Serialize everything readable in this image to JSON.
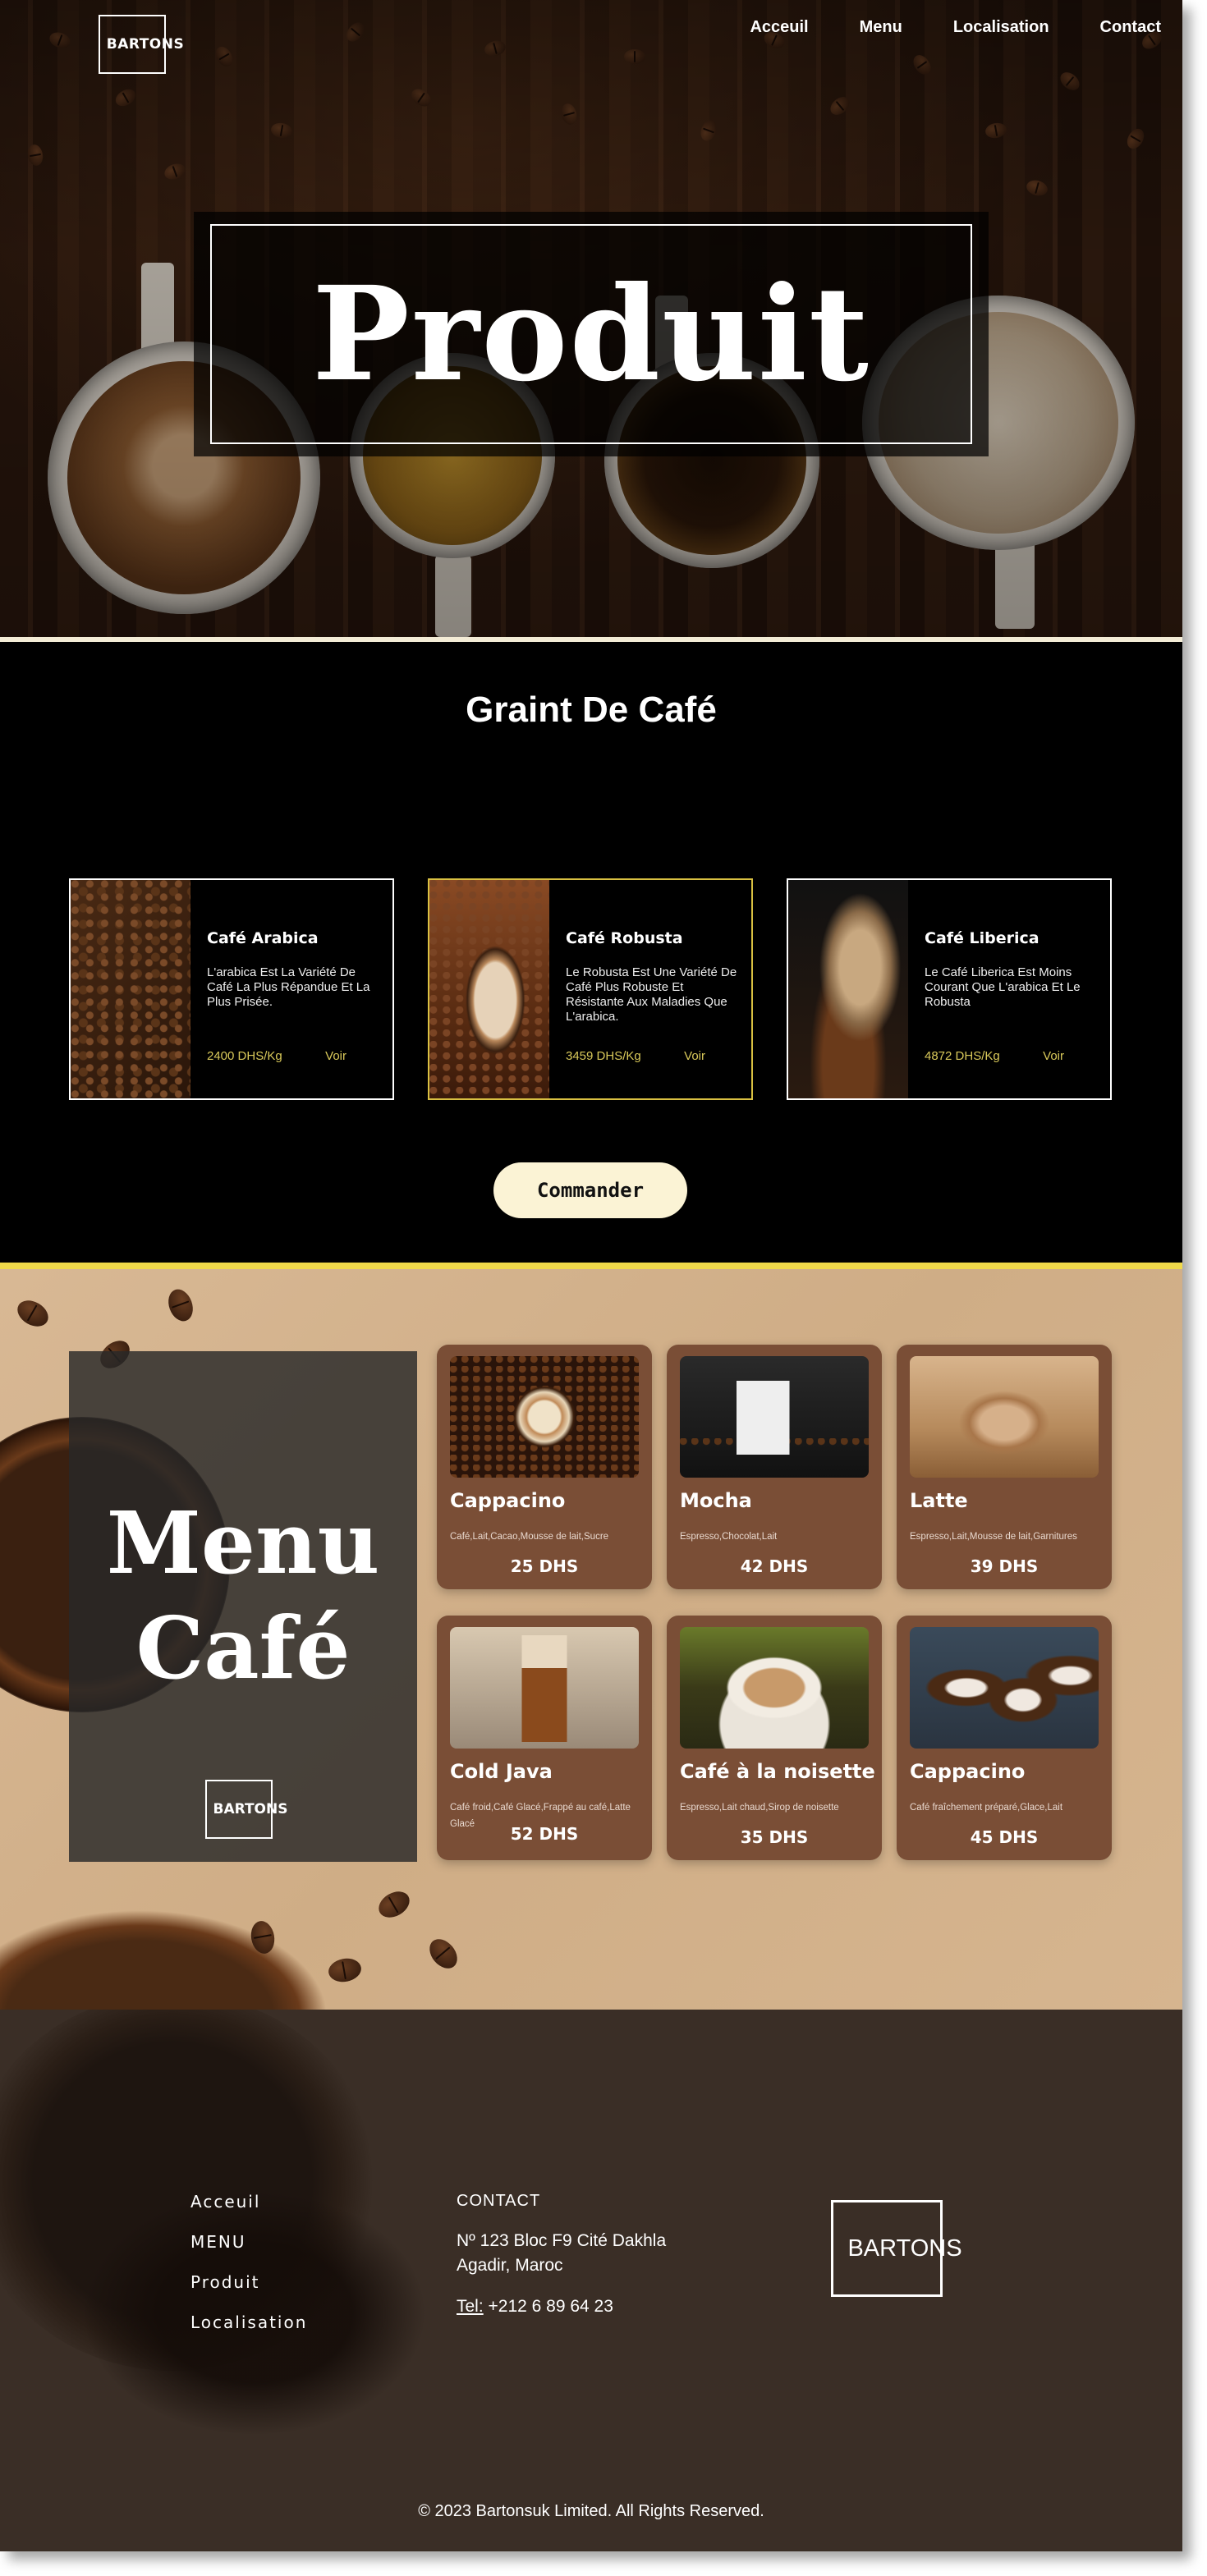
{
  "header": {
    "logo": "BARTONS",
    "nav": [
      "Acceuil",
      "Menu",
      "Localisation",
      "Contact"
    ],
    "hero_title": "Produit"
  },
  "grains": {
    "title": "Graint De Café",
    "cards": [
      {
        "name": "Café Arabica",
        "description": "L'arabica Est La Variété De Café La Plus Répandue Et La Plus Prisée.",
        "price": "2400 DHS/Kg",
        "link": "Voir"
      },
      {
        "name": "Café Robusta",
        "description": "Le Robusta Est Une Variété De Café Plus Robuste Et Résistante Aux Maladies Que L'arabica.",
        "price": "3459 DHS/Kg",
        "link": "Voir"
      },
      {
        "name": "Café Liberica",
        "description": "Le Café Liberica Est Moins Courant Que L'arabica Et Le Robusta",
        "price": "4872 DHS/Kg",
        "link": "Voir"
      }
    ],
    "order_button": "Commander"
  },
  "menu": {
    "title_line1": "Menu",
    "title_line2": "Café",
    "logo": "BARTONS",
    "items": [
      {
        "name": "Cappacino",
        "description": "Café,Lait,Cacao,Mousse de lait,Sucre",
        "price": "25 DHS"
      },
      {
        "name": "Mocha",
        "description": "Espresso,Chocolat,Lait",
        "price": "42 DHS"
      },
      {
        "name": "Latte",
        "description": "Espresso,Lait,Mousse de lait,Garnitures",
        "price": "39 DHS"
      },
      {
        "name": "Cold Java",
        "description": "Café froid,Café Glacé,Frappé au café,Latte Glacé",
        "price": "52 DHS"
      },
      {
        "name": "Café à la noisette",
        "description": "Espresso,Lait chaud,Sirop de noisette",
        "price": "35 DHS"
      },
      {
        "name": "Cappacino",
        "description": "Café fraîchement préparé,Glace,Lait",
        "price": "45 DHS"
      }
    ]
  },
  "footer": {
    "links": [
      "Acceuil",
      "MENU",
      "Produit",
      "Localisation"
    ],
    "contact_title": "CONTACT",
    "address_line1": "Nº 123 Bloc F9 Cité Dakhla",
    "address_line2": "Agadir, Maroc",
    "phone_label": "Tel:",
    "phone": " +212 6 89 64 23",
    "logo": "BARTONS",
    "copyright": "© 2023 Bartonsuk Limited. All Rights Reserved."
  },
  "colors": {
    "accent_yellow": "#f0d94a",
    "price_yellow": "#d9c95a",
    "menu_card": "#7a4e36",
    "footer_bg": "#3a2e26",
    "button_bg": "#fbf3d5"
  }
}
